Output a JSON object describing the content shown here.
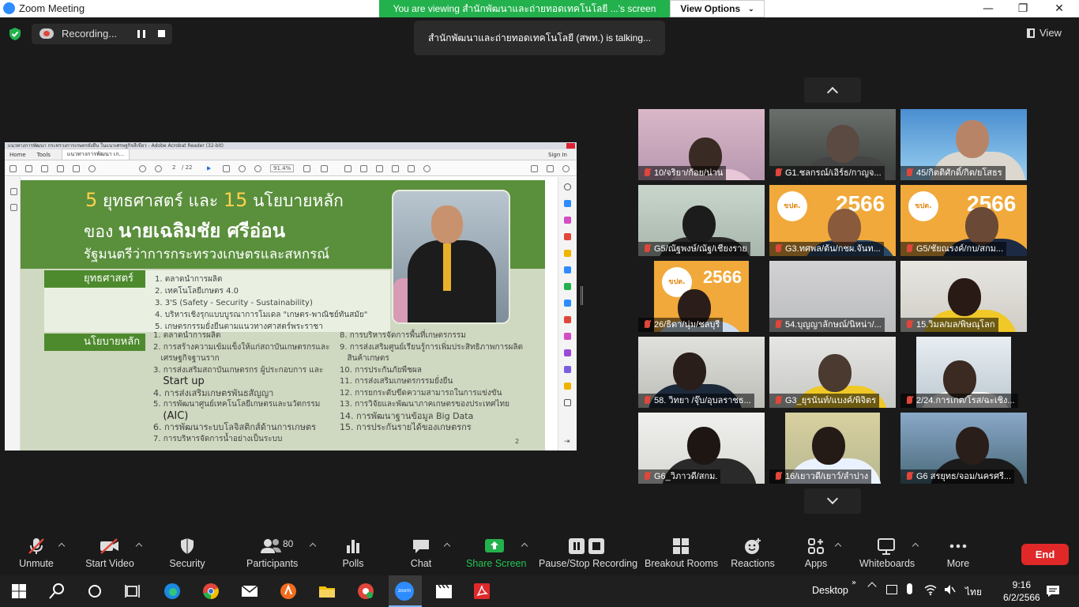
{
  "window": {
    "title": "Zoom Meeting"
  },
  "share_banner": {
    "text": "You are viewing สำนักพัฒนาและถ่ายทอดเทคโนโลยี ...'s screen",
    "view_options": "View Options"
  },
  "recording": {
    "label": "Recording..."
  },
  "talking": {
    "text": "สำนักพัฒนาและถ่ายทอดเทคโนโลยี (สพท.) is talking..."
  },
  "view_button": "View",
  "acrobat": {
    "title": "แนวทางการพัฒนา กระทรวงการเกษตรยั่งยืน ในแนวเศรษฐกิจสีเขียว - Adobe Acrobat Reader (32-bit)",
    "tabs": [
      "Home",
      "Tools",
      "แนวทางการพัฒนา เก..."
    ],
    "sign_in": "Sign In",
    "page": "2",
    "page_total": "/ 22",
    "zoom": "91.4%"
  },
  "slide": {
    "title_num1": "5",
    "title_mid": "ยุทธศาสตร์ และ",
    "title_num2": "15",
    "title_end": "นโยบายหลัก",
    "line2_prefix": "ของ",
    "line2_name": "นายเฉลิมชัย ศรีอ่อน",
    "line3": "รัฐมนตรีว่าการกระทรวงเกษตรและสหกรณ์",
    "tag1": "ยุทธศาสตร์",
    "tag2": "นโยบายหลัก",
    "strategies": [
      "1. ตลาดนำการผลิต",
      "2. เทคโนโลยีเกษตร 4.0",
      "3. 3'S (Safety - Security - Sustainability)",
      "4. บริหารเชิงรุกแบบบูรณาการโมเดล \"เกษตร-พาณิชย์ทันสมัย\"",
      "5. เกษตรกรรมยั่งยืนตามแนวทางศาสตร์พระราชา"
    ],
    "policies_left": [
      "1. ตลาดนำการผลิต",
      "2. การสร้างความเข้มแข็งให้แก่สถาบันเกษตรกรและ",
      "   เศรษฐกิจฐานราก",
      "3. การส่งเสริมสถาบันเกษตรกร ผู้ประกอบการ และ",
      "   Start up",
      "4. การส่งเสริมเกษตรพันธสัญญา",
      "5. การพัฒนาศูนย์เทคโนโลยีเกษตรและนวัตกรรม",
      "   (AIC)",
      "6. การพัฒนาระบบโลจิสติกส์ด้านการเกษตร",
      "7. การบริหารจัดการน้ำอย่างเป็นระบบ"
    ],
    "policies_right": [
      "8. การบริหารจัดการพื้นที่เกษตรกรรม",
      "9. การส่งเสริมศูนย์เรียนรู้การเพิ่มประสิทธิภาพการผลิต",
      "   สินค้าเกษตร",
      "10. การประกันภัยพืชผล",
      "11. การส่งเสริมเกษตรกรรมยั่งยืน",
      "12. การยกระดับขีดความสามารถในการแข่งขัน",
      "13. การวิจัยและพัฒนาภาคเกษตรของประเทศไทย",
      "14. การพัฒนาฐานข้อมูล Big Data",
      "15. การประกันรายได้ของเกษตรกร"
    ],
    "page_number": "2"
  },
  "participants": [
    {
      "name": "10/จริยา/ก้อย/น่าน"
    },
    {
      "name": "G1.ชลกรณ์/เอิร์ธ/กาญจ..."
    },
    {
      "name": "45/กิตติศักดิ์/กิต/ยโสธร"
    },
    {
      "name": "G5/ณัฐพงษ์/ณัฐ/เชียงราย"
    },
    {
      "name": "G3.ทศพล/ต้น/กชผ.จันท..."
    },
    {
      "name": "G5/ชัยณรงค์/กบ/สกม..."
    },
    {
      "name": "26/ธิดา/นุ่ม/ชลบุรี"
    },
    {
      "name": "54.บุญญาลักษณ์/นิหน่า/..."
    },
    {
      "name": "15.วิมล/มล/พิษณุโลก"
    },
    {
      "name": "58. วิทยา /จุ๊บ/อุบลราชธ..."
    },
    {
      "name": "G3_ยุรนันท์/แบงค์/พิจิตร"
    },
    {
      "name": "2/24.การเกต/โรส/ฉะเชิง..."
    },
    {
      "name": "G6_วิภาวดี/สกม."
    },
    {
      "name": "16/เยาวดี/เยาว์/ลำปาง"
    },
    {
      "name": "G6 สรยุทธ/จอม/นครศรี..."
    }
  ],
  "banner66": {
    "year": "2566",
    "badge": "ขปต."
  },
  "toolbar": {
    "unmute": "Unmute",
    "start_video": "Start Video",
    "security": "Security",
    "participants": "Participants",
    "participants_count": "80",
    "polls": "Polls",
    "chat": "Chat",
    "share_screen": "Share Screen",
    "pause_stop": "Pause/Stop Recording",
    "breakout": "Breakout Rooms",
    "reactions": "Reactions",
    "apps": "Apps",
    "whiteboards": "Whiteboards",
    "more": "More",
    "end": "End"
  },
  "taskbar": {
    "desktop": "Desktop",
    "lang": "ไทย",
    "time": "9:16",
    "date": "6/2/2566"
  },
  "colors": {
    "accent": "#2d8cff",
    "share_green": "#23b14d",
    "end_red": "#e02828",
    "slide_green": "#5a8f3c"
  }
}
